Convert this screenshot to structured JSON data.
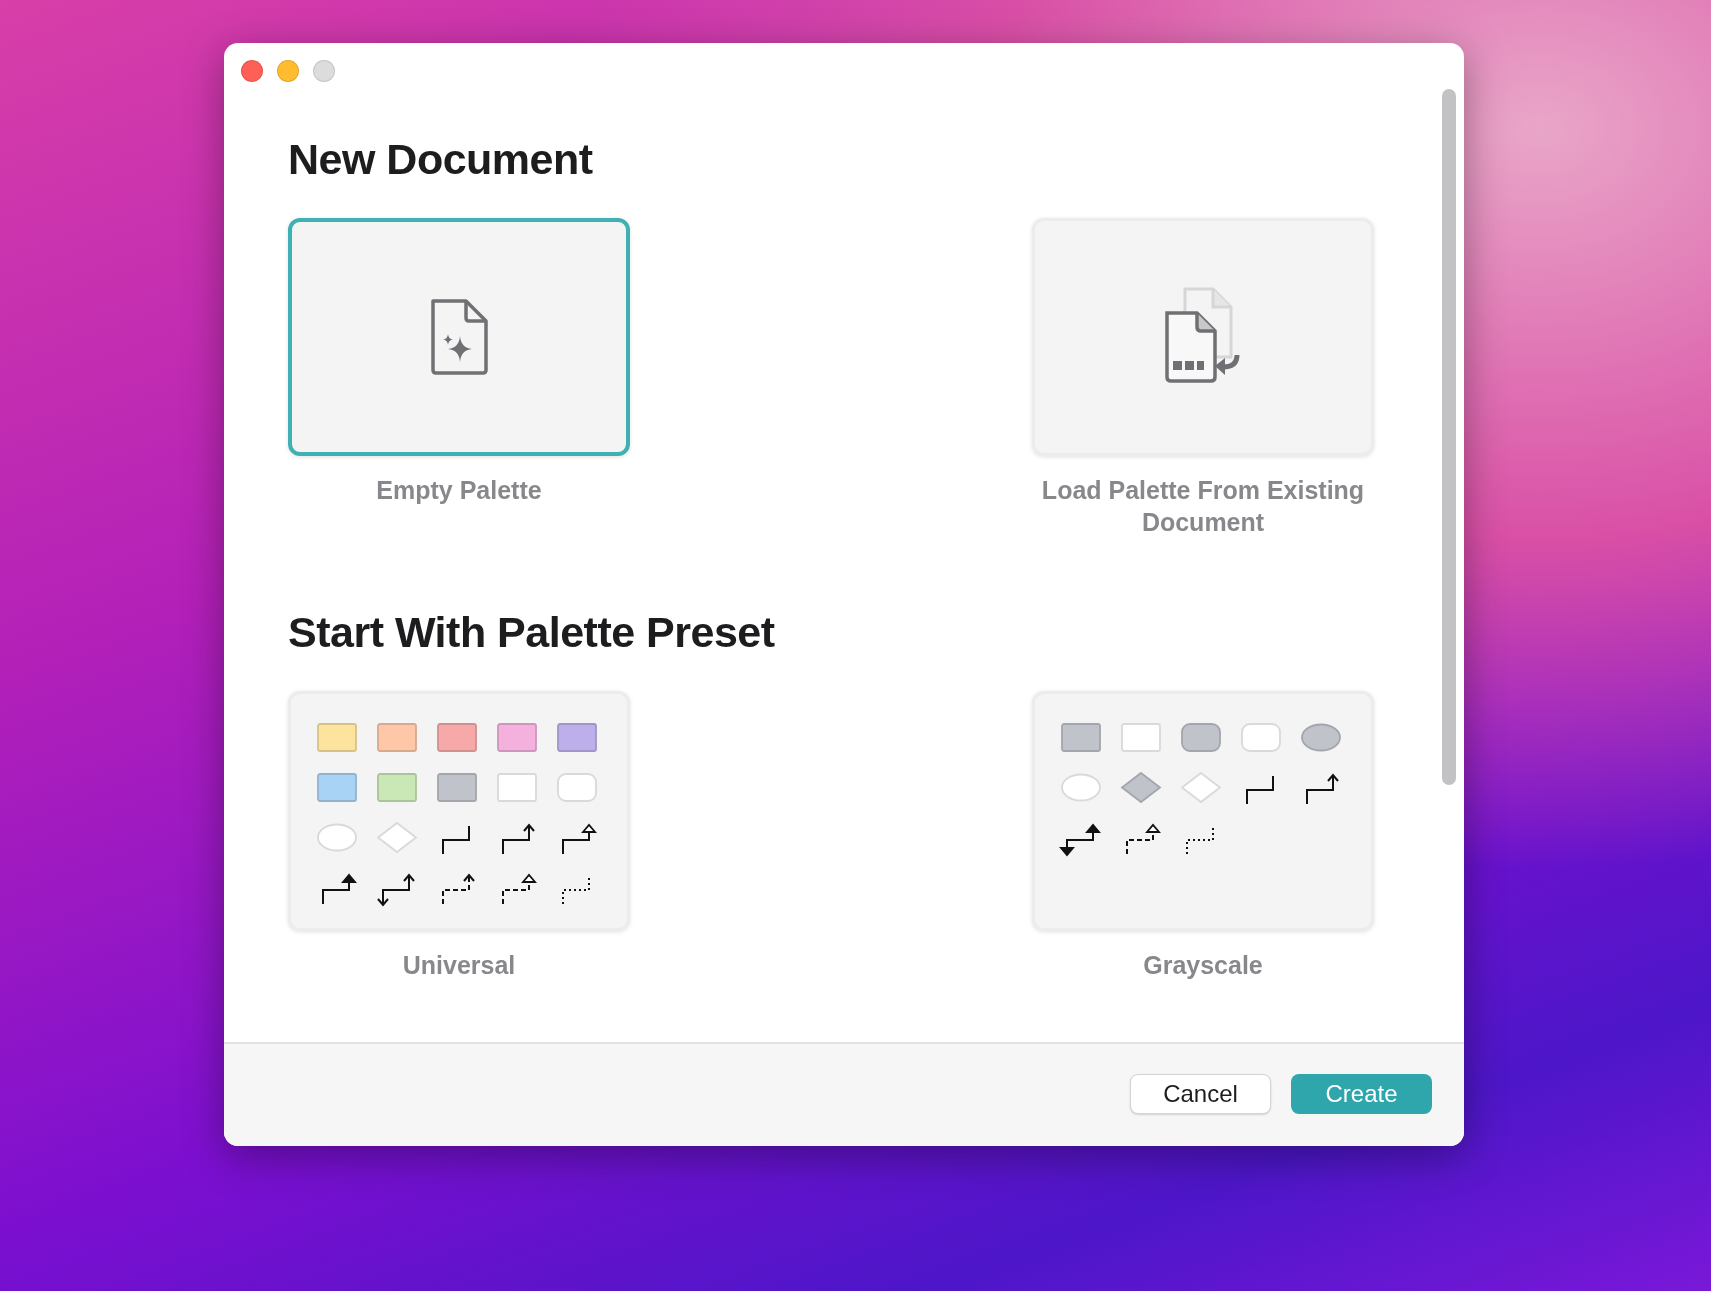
{
  "new_document": {
    "title": "New Document",
    "options": [
      {
        "kind": "empty",
        "label": "Empty Palette",
        "selected": true
      },
      {
        "kind": "load",
        "label": "Load Palette From Existing Document",
        "selected": false
      }
    ]
  },
  "presets": {
    "title": "Start With Palette Preset",
    "items": [
      {
        "label": "Universal",
        "selected": false,
        "shapes": [
          {
            "kind": "rect",
            "color": "#fde49e"
          },
          {
            "kind": "rect",
            "color": "#fdc7a8"
          },
          {
            "kind": "rect",
            "color": "#f7a9aa"
          },
          {
            "kind": "rect",
            "color": "#f4b1de"
          },
          {
            "kind": "rect",
            "color": "#bdb0ea"
          },
          {
            "kind": "rect",
            "color": "#a9d3f5"
          },
          {
            "kind": "rect",
            "color": "#c9e8b5"
          },
          {
            "kind": "rect",
            "color": "#c0c3ca"
          },
          {
            "kind": "rect",
            "color": "#ffffff"
          },
          {
            "kind": "rounded",
            "color": "#ffffff"
          },
          {
            "kind": "ellipse",
            "color": "#ffffff"
          },
          {
            "kind": "diamond",
            "color": "#ffffff"
          },
          {
            "kind": "connector"
          },
          {
            "kind": "connector",
            "head_open": true
          },
          {
            "kind": "connector",
            "head_hollow": true
          },
          {
            "kind": "connector",
            "head_filled": true
          },
          {
            "kind": "connector",
            "head_open": true,
            "tail_open": true
          },
          {
            "kind": "connector",
            "dashed": true,
            "head_open": true
          },
          {
            "kind": "connector",
            "dashed": true,
            "head_hollow": true
          },
          {
            "kind": "connector",
            "dotted": true
          }
        ]
      },
      {
        "label": "Grayscale",
        "selected": false,
        "shapes": [
          {
            "kind": "rect",
            "color": "#c0c3ca"
          },
          {
            "kind": "rect",
            "color": "#ffffff"
          },
          {
            "kind": "rounded",
            "color": "#c0c3ca"
          },
          {
            "kind": "rounded",
            "color": "#ffffff"
          },
          {
            "kind": "ellipse",
            "color": "#c0c3ca"
          },
          {
            "kind": "ellipse",
            "color": "#ffffff"
          },
          {
            "kind": "diamond",
            "color": "#c0c3ca"
          },
          {
            "kind": "diamond",
            "color": "#ffffff"
          },
          {
            "kind": "connector"
          },
          {
            "kind": "connector",
            "head_open": true
          },
          {
            "kind": "connector",
            "head_filled": true,
            "tail_filled": true
          },
          {
            "kind": "connector",
            "dashed": true,
            "head_hollow": true
          },
          {
            "kind": "connector",
            "dotted": true
          }
        ]
      }
    ]
  },
  "buttons": [
    {
      "kind": "secondary",
      "label": "Cancel"
    },
    {
      "kind": "primary",
      "label": "Create"
    }
  ]
}
